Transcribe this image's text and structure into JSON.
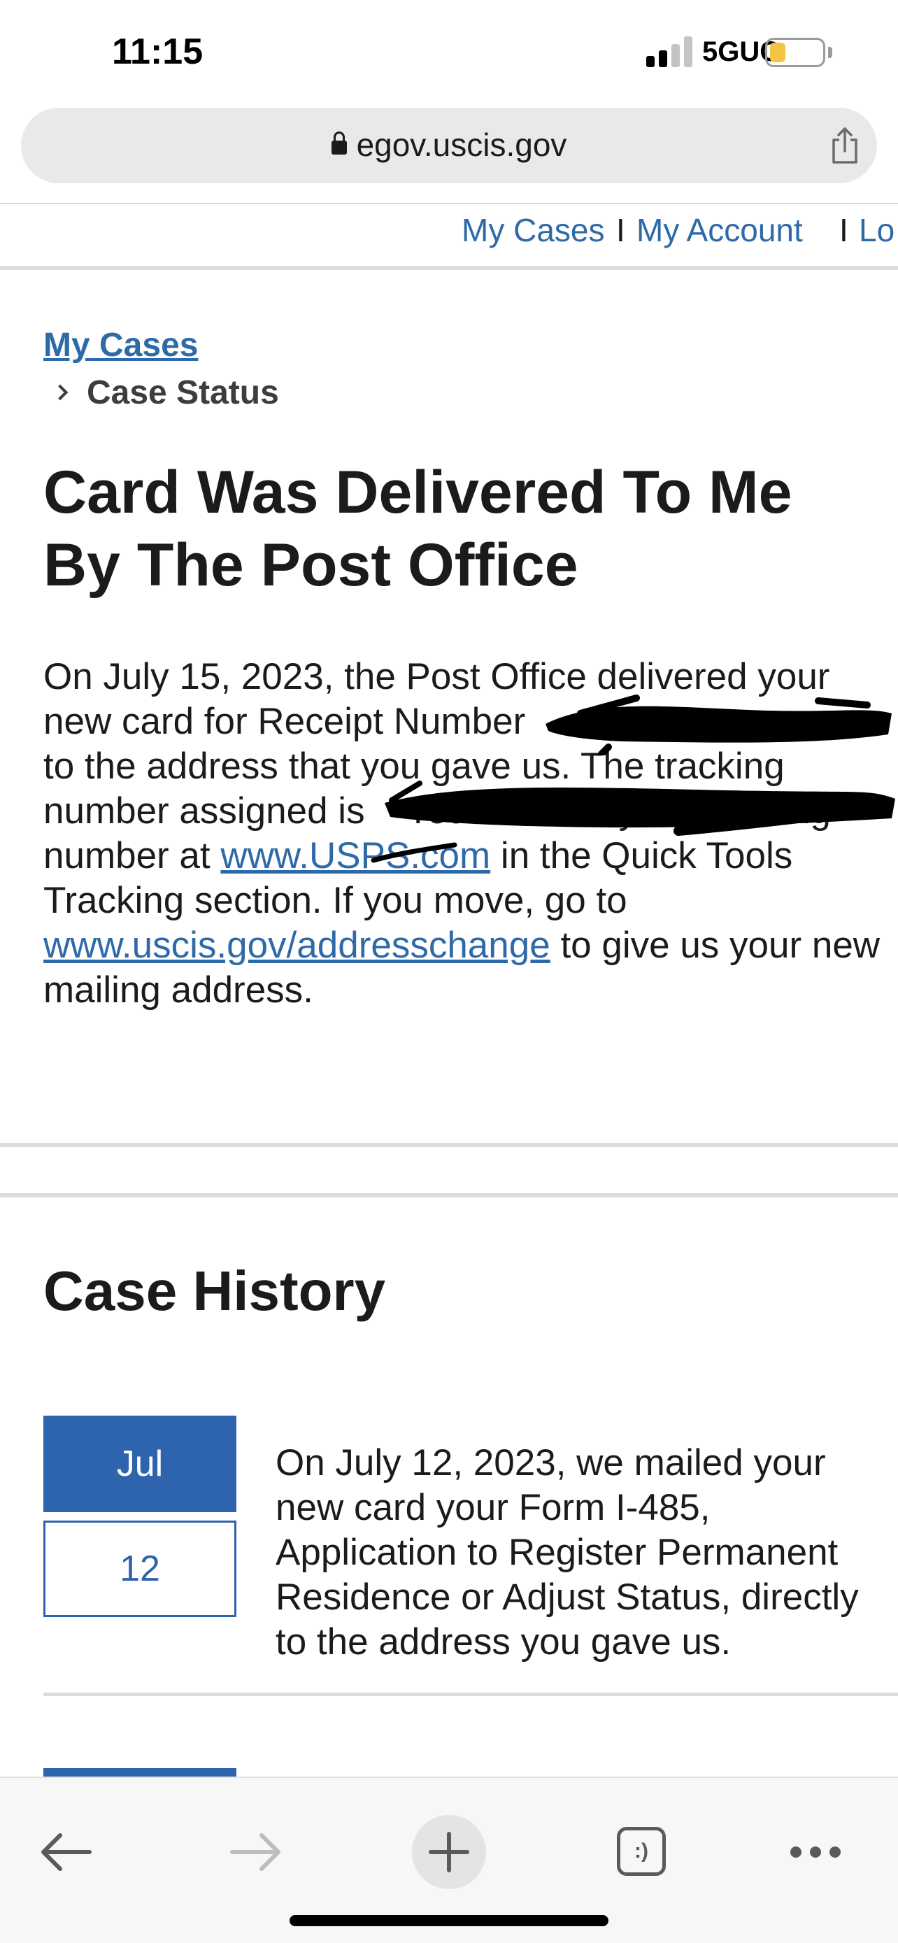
{
  "status_bar": {
    "time": "11:15",
    "network": "5GUC",
    "battery_level": 0.3,
    "battery_color": "#f4c542"
  },
  "browser": {
    "url": "egov.uscis.gov",
    "lock_icon": "lock-icon",
    "share_icon": "share-icon"
  },
  "top_nav": {
    "items": [
      {
        "label": "My Cases"
      },
      {
        "label": "My Account"
      },
      {
        "label": "Lo"
      }
    ],
    "separator": "I"
  },
  "breadcrumb": {
    "parent": "My Cases",
    "current": "Case Status"
  },
  "case_status": {
    "title": "Card Was Delivered To Me By The Post Office",
    "body_part1": "On July 15, 2023, the Post Office delivered your new card for Receipt Number",
    "body_part2": "to the address that you gave us. The tracking number assigned is",
    "body_part3": "You can use your tracking number at",
    "usps_link": "www.USPS.com",
    "body_part4": "in the Quick Tools Tracking section. If you move, go to",
    "address_link": "www.uscis.gov/addresschange",
    "body_part5": "to give us your new mailing address."
  },
  "case_history": {
    "title": "Case History",
    "entries": [
      {
        "month": "Jul",
        "day": "12",
        "text_lines": [
          "On July 12, 2023, we mailed your",
          "new card your Form I-485,",
          "Application to Register Permanent",
          "Residence or Adjust Status, directly",
          "to the address you gave us."
        ]
      }
    ]
  },
  "toolbar": {
    "back_icon": "back-arrow-icon",
    "forward_icon": "forward-arrow-icon",
    "new_tab_icon": "plus-icon",
    "tabs_icon": "tabs-icon",
    "tabs_label": ":)",
    "more_icon": "more-icon"
  },
  "colors": {
    "link": "#2e6aa8",
    "accent": "#2e63ad",
    "divider": "#dcdcdc"
  }
}
